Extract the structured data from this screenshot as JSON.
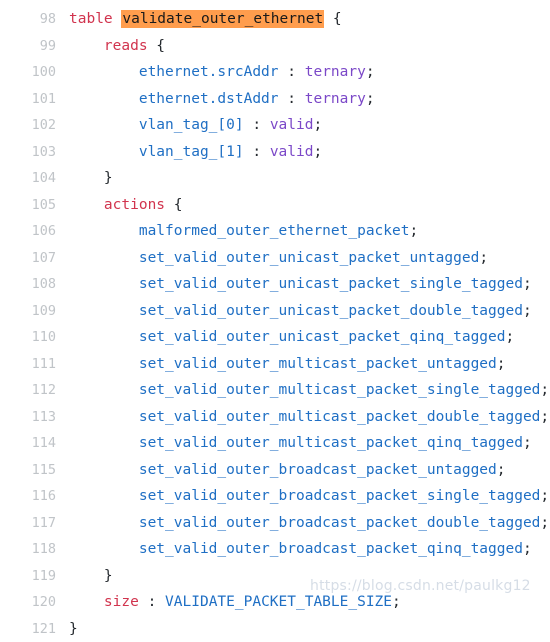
{
  "editor": {
    "language": "p4",
    "background_color": "#ffffff",
    "gutter_color": "#c0c4c8",
    "default_text_color": "#24292e",
    "colors": {
      "keyword": "#d1344e",
      "identifier": "#1f6fc4",
      "type": "#7b48c8",
      "punctuation": "#24292e",
      "highlight_background": "#ff9d4d",
      "highlight_text": "#1a1a1a",
      "watermark": "#d6dde6"
    },
    "first_line_number": 98,
    "last_line_number": 121,
    "lines": [
      {
        "number": "98",
        "indent": "",
        "tokens": [
          {
            "text": "table",
            "kind": "keyword"
          },
          {
            "text": " ",
            "kind": "plain"
          },
          {
            "text": "validate_outer_ethernet",
            "kind": "highlight"
          },
          {
            "text": " {",
            "kind": "punctuation"
          }
        ]
      },
      {
        "number": "99",
        "indent": "    ",
        "tokens": [
          {
            "text": "reads",
            "kind": "keyword"
          },
          {
            "text": " {",
            "kind": "punctuation"
          }
        ]
      },
      {
        "number": "100",
        "indent": "        ",
        "tokens": [
          {
            "text": "ethernet.srcAddr",
            "kind": "identifier"
          },
          {
            "text": " : ",
            "kind": "punctuation"
          },
          {
            "text": "ternary",
            "kind": "type"
          },
          {
            "text": ";",
            "kind": "punctuation"
          }
        ]
      },
      {
        "number": "101",
        "indent": "        ",
        "tokens": [
          {
            "text": "ethernet.dstAddr",
            "kind": "identifier"
          },
          {
            "text": " : ",
            "kind": "punctuation"
          },
          {
            "text": "ternary",
            "kind": "type"
          },
          {
            "text": ";",
            "kind": "punctuation"
          }
        ]
      },
      {
        "number": "102",
        "indent": "        ",
        "tokens": [
          {
            "text": "vlan_tag_[0]",
            "kind": "identifier"
          },
          {
            "text": " : ",
            "kind": "punctuation"
          },
          {
            "text": "valid",
            "kind": "type"
          },
          {
            "text": ";",
            "kind": "punctuation"
          }
        ]
      },
      {
        "number": "103",
        "indent": "        ",
        "tokens": [
          {
            "text": "vlan_tag_[1]",
            "kind": "identifier"
          },
          {
            "text": " : ",
            "kind": "punctuation"
          },
          {
            "text": "valid",
            "kind": "type"
          },
          {
            "text": ";",
            "kind": "punctuation"
          }
        ]
      },
      {
        "number": "104",
        "indent": "    ",
        "tokens": [
          {
            "text": "}",
            "kind": "punctuation"
          }
        ]
      },
      {
        "number": "105",
        "indent": "    ",
        "tokens": [
          {
            "text": "actions",
            "kind": "keyword"
          },
          {
            "text": " {",
            "kind": "punctuation"
          }
        ]
      },
      {
        "number": "106",
        "indent": "        ",
        "tokens": [
          {
            "text": "malformed_outer_ethernet_packet",
            "kind": "identifier"
          },
          {
            "text": ";",
            "kind": "punctuation"
          }
        ]
      },
      {
        "number": "107",
        "indent": "        ",
        "tokens": [
          {
            "text": "set_valid_outer_unicast_packet_untagged",
            "kind": "identifier"
          },
          {
            "text": ";",
            "kind": "punctuation"
          }
        ]
      },
      {
        "number": "108",
        "indent": "        ",
        "tokens": [
          {
            "text": "set_valid_outer_unicast_packet_single_tagged",
            "kind": "identifier"
          },
          {
            "text": ";",
            "kind": "punctuation"
          }
        ]
      },
      {
        "number": "109",
        "indent": "        ",
        "tokens": [
          {
            "text": "set_valid_outer_unicast_packet_double_tagged",
            "kind": "identifier"
          },
          {
            "text": ";",
            "kind": "punctuation"
          }
        ]
      },
      {
        "number": "110",
        "indent": "        ",
        "tokens": [
          {
            "text": "set_valid_outer_unicast_packet_qinq_tagged",
            "kind": "identifier"
          },
          {
            "text": ";",
            "kind": "punctuation"
          }
        ]
      },
      {
        "number": "111",
        "indent": "        ",
        "tokens": [
          {
            "text": "set_valid_outer_multicast_packet_untagged",
            "kind": "identifier"
          },
          {
            "text": ";",
            "kind": "punctuation"
          }
        ]
      },
      {
        "number": "112",
        "indent": "        ",
        "tokens": [
          {
            "text": "set_valid_outer_multicast_packet_single_tagged",
            "kind": "identifier"
          },
          {
            "text": ";",
            "kind": "punctuation"
          }
        ]
      },
      {
        "number": "113",
        "indent": "        ",
        "tokens": [
          {
            "text": "set_valid_outer_multicast_packet_double_tagged",
            "kind": "identifier"
          },
          {
            "text": ";",
            "kind": "punctuation"
          }
        ]
      },
      {
        "number": "114",
        "indent": "        ",
        "tokens": [
          {
            "text": "set_valid_outer_multicast_packet_qinq_tagged",
            "kind": "identifier"
          },
          {
            "text": ";",
            "kind": "punctuation"
          }
        ]
      },
      {
        "number": "115",
        "indent": "        ",
        "tokens": [
          {
            "text": "set_valid_outer_broadcast_packet_untagged",
            "kind": "identifier"
          },
          {
            "text": ";",
            "kind": "punctuation"
          }
        ]
      },
      {
        "number": "116",
        "indent": "        ",
        "tokens": [
          {
            "text": "set_valid_outer_broadcast_packet_single_tagged",
            "kind": "identifier"
          },
          {
            "text": ";",
            "kind": "punctuation"
          }
        ]
      },
      {
        "number": "117",
        "indent": "        ",
        "tokens": [
          {
            "text": "set_valid_outer_broadcast_packet_double_tagged",
            "kind": "identifier"
          },
          {
            "text": ";",
            "kind": "punctuation"
          }
        ]
      },
      {
        "number": "118",
        "indent": "        ",
        "tokens": [
          {
            "text": "set_valid_outer_broadcast_packet_qinq_tagged",
            "kind": "identifier"
          },
          {
            "text": ";",
            "kind": "punctuation"
          }
        ]
      },
      {
        "number": "119",
        "indent": "    ",
        "tokens": [
          {
            "text": "}",
            "kind": "punctuation"
          }
        ]
      },
      {
        "number": "120",
        "indent": "    ",
        "tokens": [
          {
            "text": "size",
            "kind": "keyword"
          },
          {
            "text": " : ",
            "kind": "punctuation"
          },
          {
            "text": "VALIDATE_PACKET_TABLE_SIZE",
            "kind": "identifier"
          },
          {
            "text": ";",
            "kind": "punctuation"
          }
        ]
      },
      {
        "number": "121",
        "indent": "",
        "tokens": [
          {
            "text": "}",
            "kind": "punctuation"
          }
        ]
      }
    ]
  },
  "watermark": {
    "text": "https://blog.csdn.net/paulkg12"
  }
}
